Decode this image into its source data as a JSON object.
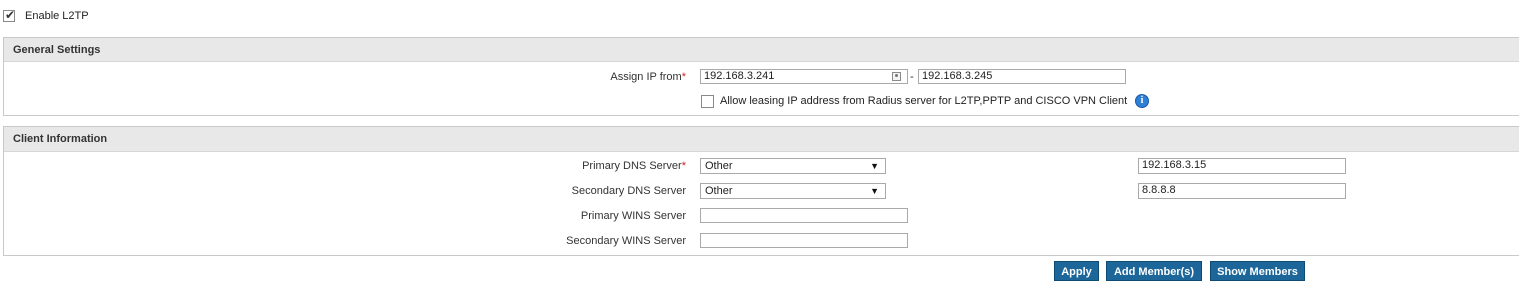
{
  "enable": {
    "label": "Enable L2TP",
    "checked": true
  },
  "general": {
    "title": "General Settings",
    "assign_ip_label": "Assign IP from",
    "required_mark": "*",
    "ip_start": "192.168.3.241",
    "range_sep": "-",
    "ip_end": "192.168.3.245",
    "radius_label": "Allow leasing IP address from Radius server for L2TP,PPTP and CISCO VPN Client",
    "radius_checked": false,
    "info_glyph": "i"
  },
  "client": {
    "title": "Client Information",
    "required_mark": "*",
    "primary_dns_label": "Primary DNS Server",
    "primary_dns_select": "Other",
    "primary_dns_value": "192.168.3.15",
    "secondary_dns_label": "Secondary DNS Server",
    "secondary_dns_select": "Other",
    "secondary_dns_value": "8.8.8.8",
    "primary_wins_label": "Primary WINS Server",
    "primary_wins_value": "",
    "secondary_wins_label": "Secondary WINS Server",
    "secondary_wins_value": ""
  },
  "buttons": {
    "apply": "Apply",
    "add_members": "Add Member(s)",
    "show_members": "Show Members"
  },
  "icons": {
    "check": "checkmark-icon",
    "info": "info-icon",
    "address_book": "address-book-icon",
    "dropdown": "chevron-down-icon"
  },
  "colors": {
    "button_bg": "#1c6699",
    "required": "#cc2222",
    "panel_header": "#e8e8e8",
    "info_icon": "#2f7fd6"
  }
}
